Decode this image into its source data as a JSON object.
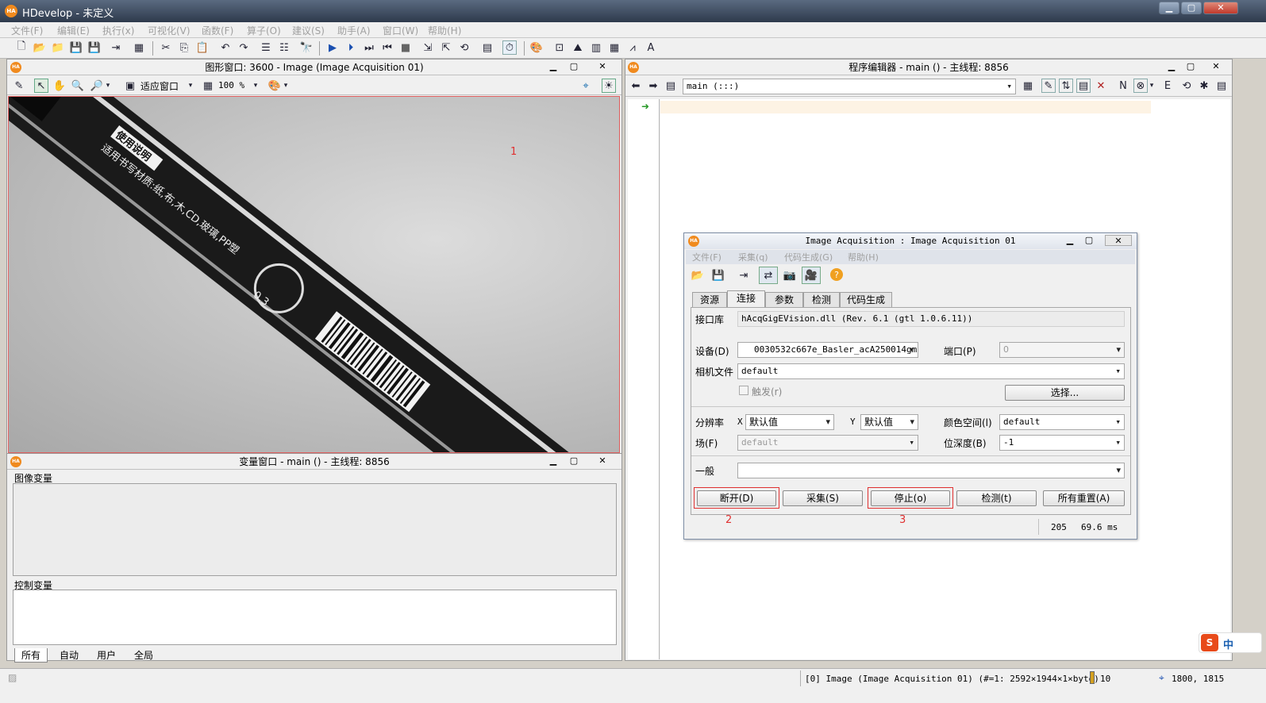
{
  "window": {
    "title": "HDevelop - 未定义",
    "logo": "HA"
  },
  "menu": [
    "文件(F)",
    "编辑(E)",
    "执行(x)",
    "可视化(V)",
    "函数(F)",
    "算子(O)",
    "建议(S)",
    "助手(A)",
    "窗口(W)",
    "帮助(H)"
  ],
  "graphics_window": {
    "title": "图形窗口: 3600 - Image (Image Acquisition 01)",
    "fit_label": "适应窗口",
    "zoom_value": "100 %",
    "annotation": "1"
  },
  "variable_window": {
    "title": "变量窗口 - main () - 主线程: 8856",
    "image_vars_label": "图像变量",
    "control_vars_label": "控制变量",
    "tabs": [
      "所有",
      "自动",
      "用户",
      "全局"
    ]
  },
  "program_editor": {
    "title": "程序编辑器 - main () - 主线程: 8856",
    "procedure": "main (:::)"
  },
  "acq_dialog": {
    "title": "Image Acquisition : Image Acquisition 01",
    "menu": [
      "文件(F)",
      "采集(q)",
      "代码生成(G)",
      "帮助(H)"
    ],
    "tabs": [
      "资源",
      "连接",
      "参数",
      "检测",
      "代码生成"
    ],
    "interface_label": "接口库",
    "interface_value": "hAcqGigEVision.dll (Rev. 6.1 (gtl 1.0.6.11))",
    "device_label": "设备(D)",
    "device_value": "0030532c667e_Basler_acA250014gm",
    "port_label": "端口(P)",
    "port_value": "0",
    "camfile_label": "相机文件",
    "camfile_value": "default",
    "trigger_label": "触发(r)",
    "select_button": "选择...",
    "resolution_label": "分辨率",
    "x_label": "X",
    "x_value": "默认值",
    "y_label": "Y",
    "y_value": "默认值",
    "colorspace_label": "颜色空间(l)",
    "colorspace_value": "default",
    "field_label": "场(F)",
    "field_value": "default",
    "bitdepth_label": "位深度(B)",
    "bitdepth_value": "-1",
    "general_label": "一般",
    "general_value": "",
    "buttons": [
      "断开(D)",
      "采集(S)",
      "停止(o)",
      "检测(t)",
      "所有重置(A)"
    ],
    "annot_2": "2",
    "annot_3": "3",
    "status_count": "205",
    "status_time": "69.6 ms"
  },
  "statusbar": {
    "image_info": "[0] Image (Image Acquisition 01) (#=1: 2592×1944×1×byte)",
    "value": "10",
    "coords": "1800, 1815"
  },
  "ime": {
    "label": "中"
  },
  "pen_text": {
    "badge": "使用说明",
    "line1": "适用书写材质:纸,布,木,CD,玻璃,PP塑",
    "line2": "0.3"
  }
}
